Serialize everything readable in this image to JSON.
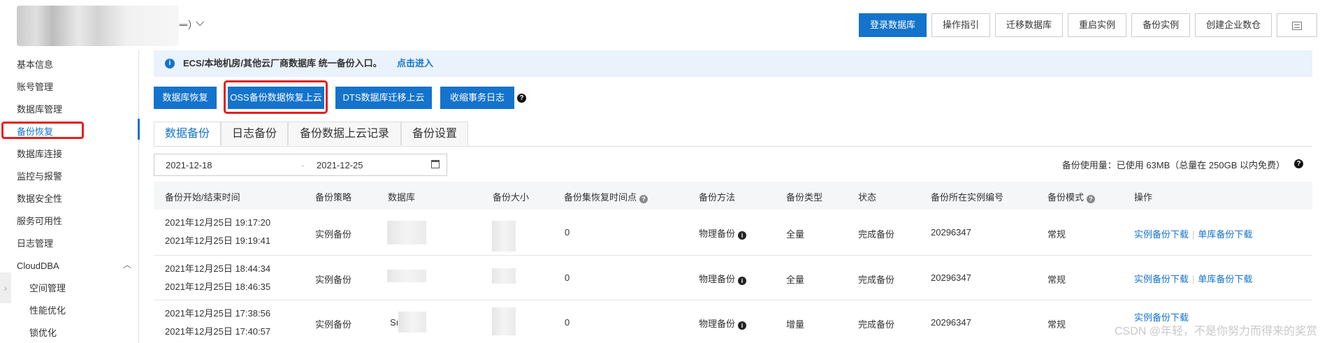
{
  "header": {
    "instance_name_suffix": "ᆖ）",
    "top_actions": [
      "登录数据库",
      "操作指引",
      "迁移数据库",
      "重启实例",
      "备份实例",
      "创建企业数仓"
    ]
  },
  "sidebar": {
    "items": [
      "基本信息",
      "账号管理",
      "数据库管理",
      "备份恢复",
      "数据库连接",
      "监控与报警",
      "数据安全性",
      "服务可用性",
      "日志管理",
      "CloudDBA",
      "空间管理",
      "性能优化",
      "锁优化"
    ]
  },
  "notice": {
    "text": "ECS/本地机房/其他云厂商数据库 统一备份入口。",
    "link": "点击进入"
  },
  "actions": [
    "数据库恢复",
    "OSS备份数据恢复上云",
    "DTS数据库迁移上云",
    "收缩事务日志"
  ],
  "tabs": [
    "数据备份",
    "日志备份",
    "备份数据上云记录",
    "备份设置"
  ],
  "date_range": {
    "start": "2021-12-18",
    "separator": "-",
    "end": "2021-12-25"
  },
  "usage": "备份使用量：已使用 63MB（总量在 250GB 以内免费）",
  "table": {
    "headers": [
      "备份开始/结束时间",
      "备份策略",
      "数据库",
      "备份大小",
      "备份集恢复时间点",
      "备份方法",
      "备份类型",
      "状态",
      "备份所在实例编号",
      "备份模式",
      "操作"
    ],
    "rows": [
      {
        "start": "2021年12月25日 19:17:20",
        "end": "2021年12月25日 19:19:41",
        "strategy": "实例备份",
        "database": "",
        "size": "",
        "restore_point": "0",
        "method": "物理备份",
        "type": "全量",
        "status": "完成备份",
        "instance_id": "20296347",
        "mode": "常规",
        "op1": "实例备份下载",
        "op2": "单库备份下载"
      },
      {
        "start": "2021年12月25日 18:44:34",
        "end": "2021年12月25日 18:46:35",
        "strategy": "实例备份",
        "database": "",
        "size": "",
        "restore_point": "0",
        "method": "物理备份",
        "type": "全量",
        "status": "完成备份",
        "instance_id": "20296347",
        "mode": "常规",
        "op1": "实例备份下载",
        "op2": "单库备份下载"
      },
      {
        "start": "2021年12月25日 17:38:56",
        "end": "2021年12月25日 17:40:57",
        "strategy": "实例备份",
        "database": "Sı",
        "size": "",
        "restore_point": "0",
        "method": "物理备份",
        "type": "增量",
        "status": "完成备份",
        "instance_id": "20296347",
        "mode": "常规",
        "op1": "实例备份下载",
        "op2": ""
      }
    ]
  },
  "watermark": "CSDN @年轻，不是你努力而得来的奖赏",
  "colors": {
    "primary": "#1473cc",
    "highlight": "#e41f1f",
    "notice_bg": "#eaf2fb"
  }
}
